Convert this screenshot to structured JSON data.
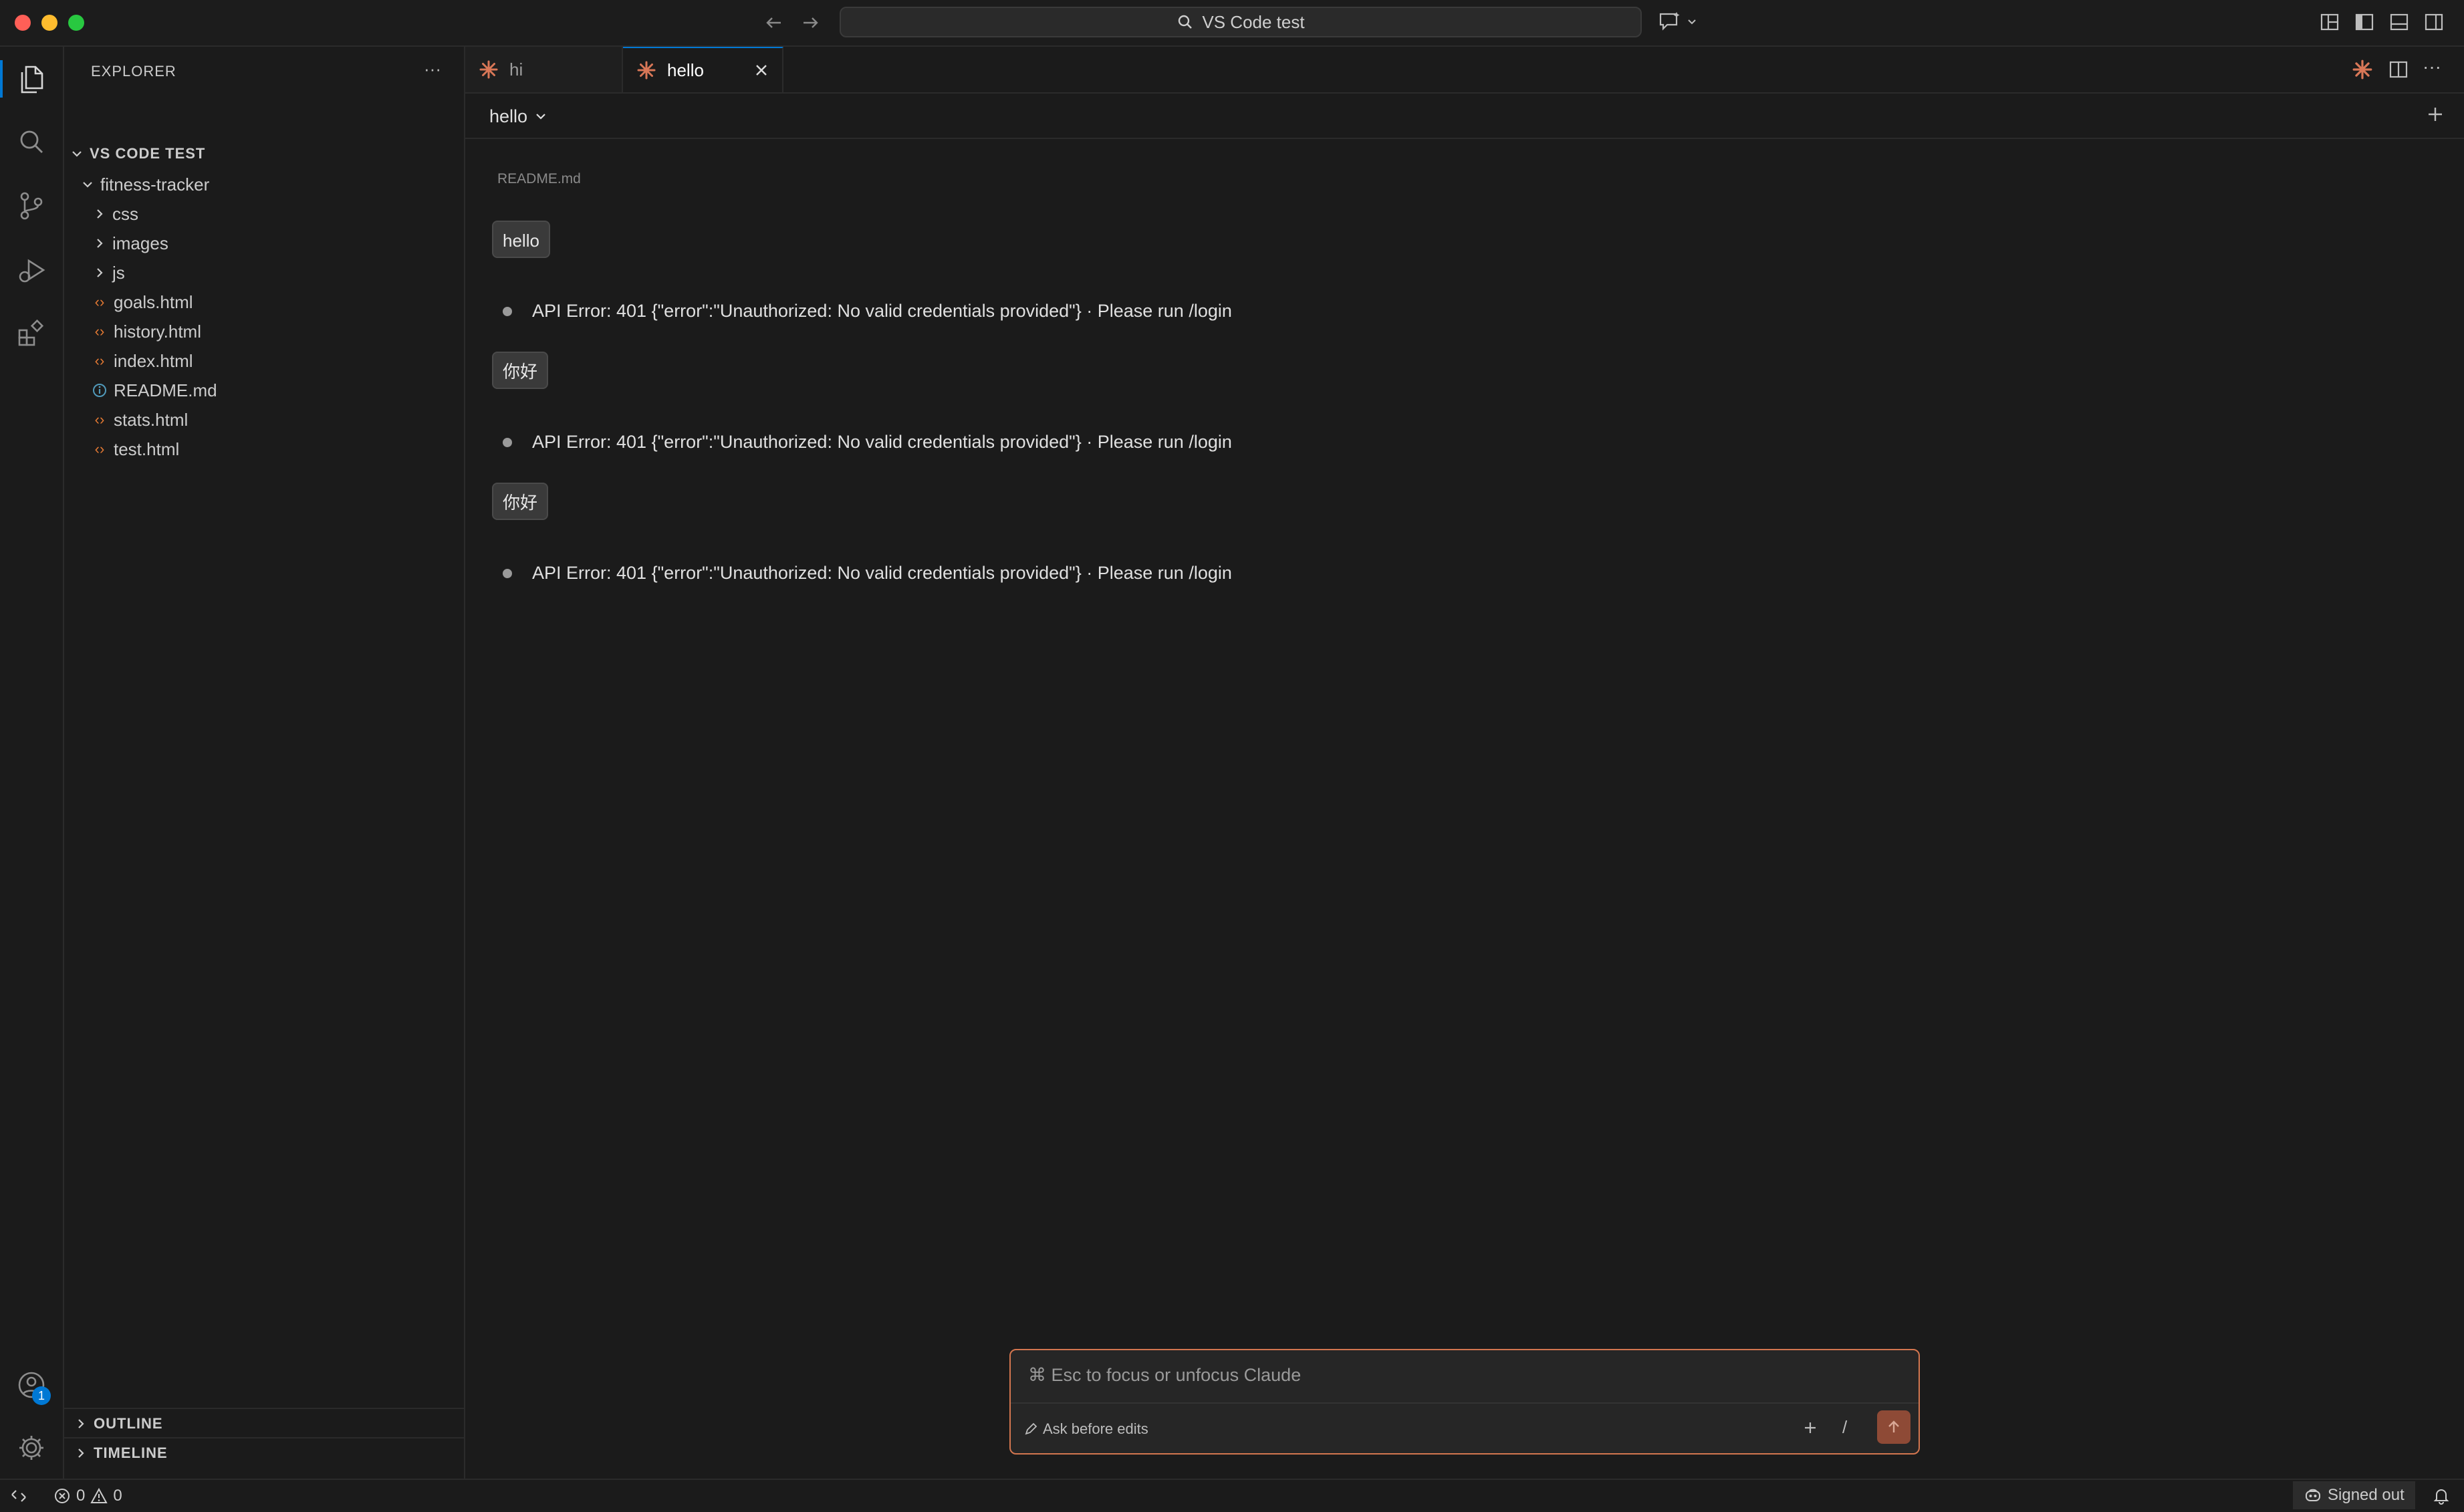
{
  "colors": {
    "accent": "#0078d4",
    "claude_orange": "#d97757",
    "prompt_border": "#d3764f",
    "html_icon": "#e37933",
    "info_icon": "#519aba"
  },
  "titlebar": {
    "search_text": "VS Code test"
  },
  "sidebar": {
    "title": "EXPLORER",
    "workspace": "VS CODE TEST",
    "folder": "fitness-tracker",
    "subfolders": [
      "css",
      "images",
      "js"
    ],
    "files": [
      {
        "name": "goals.html",
        "icon": "code-icon"
      },
      {
        "name": "history.html",
        "icon": "code-icon"
      },
      {
        "name": "index.html",
        "icon": "code-icon"
      },
      {
        "name": "README.md",
        "icon": "info-icon"
      },
      {
        "name": "stats.html",
        "icon": "code-icon"
      },
      {
        "name": "test.html",
        "icon": "code-icon"
      }
    ],
    "outline": "OUTLINE",
    "timeline": "TIMELINE"
  },
  "tabs": [
    {
      "label": "hi",
      "active": false
    },
    {
      "label": "hello",
      "active": true
    }
  ],
  "editor": {
    "session_title": "hello",
    "context_file": "README.md",
    "messages": [
      {
        "role": "user",
        "text": "hello"
      },
      {
        "role": "assistant",
        "text": "API Error: 401 {\"error\":\"Unauthorized: No valid credentials provided\"} · Please run /login"
      },
      {
        "role": "user",
        "text": "你好"
      },
      {
        "role": "assistant",
        "text": "API Error: 401 {\"error\":\"Unauthorized: No valid credentials provided\"} · Please run /login"
      },
      {
        "role": "user",
        "text": "你好"
      },
      {
        "role": "assistant",
        "text": "API Error: 401 {\"error\":\"Unauthorized: No valid credentials provided\"} · Please run /login"
      }
    ]
  },
  "prompt": {
    "placeholder": "⌘ Esc to focus or unfocus Claude",
    "mode": "Ask before edits",
    "slash": "/"
  },
  "activity": {
    "accounts_badge": "1"
  },
  "statusbar": {
    "errors": "0",
    "warnings": "0",
    "signed_out": "Signed out"
  }
}
